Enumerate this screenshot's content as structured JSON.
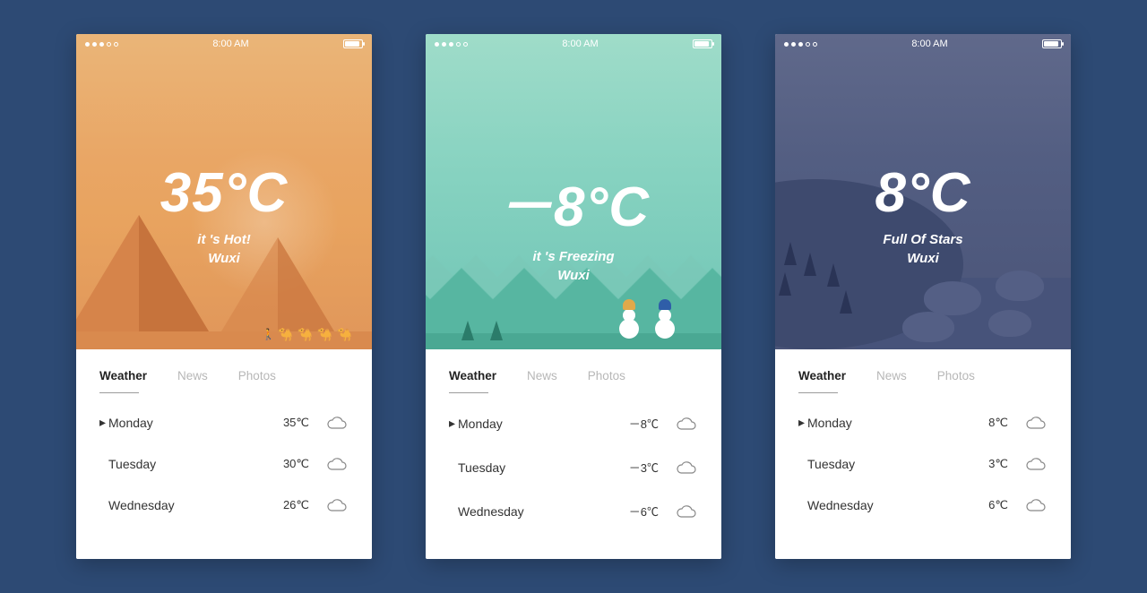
{
  "statusTime": "8:00 AM",
  "tabs": {
    "weather": "Weather",
    "news": "News",
    "photos": "Photos"
  },
  "screens": [
    {
      "theme": "hot",
      "temp": "35°C",
      "caption1": "it 's Hot!",
      "caption2": "Wuxi",
      "forecast": [
        {
          "day": "Monday",
          "temp": "35℃",
          "marker": "▸"
        },
        {
          "day": "Tuesday",
          "temp": "30℃",
          "marker": ""
        },
        {
          "day": "Wednesday",
          "temp": "26℃",
          "marker": ""
        }
      ]
    },
    {
      "theme": "cold",
      "temp": "－8°C",
      "caption1": "it 's Freezing",
      "caption2": "Wuxi",
      "forecast": [
        {
          "day": "Monday",
          "temp": "－8℃",
          "marker": "▸"
        },
        {
          "day": "Tuesday",
          "temp": "－3℃",
          "marker": ""
        },
        {
          "day": "Wednesday",
          "temp": "－6℃",
          "marker": ""
        }
      ]
    },
    {
      "theme": "night",
      "temp": "8°C",
      "caption1": "Full Of Stars",
      "caption2": "Wuxi",
      "forecast": [
        {
          "day": "Monday",
          "temp": "8℃",
          "marker": "▸"
        },
        {
          "day": "Tuesday",
          "temp": "3℃",
          "marker": ""
        },
        {
          "day": "Wednesday",
          "temp": "6℃",
          "marker": ""
        }
      ]
    }
  ]
}
